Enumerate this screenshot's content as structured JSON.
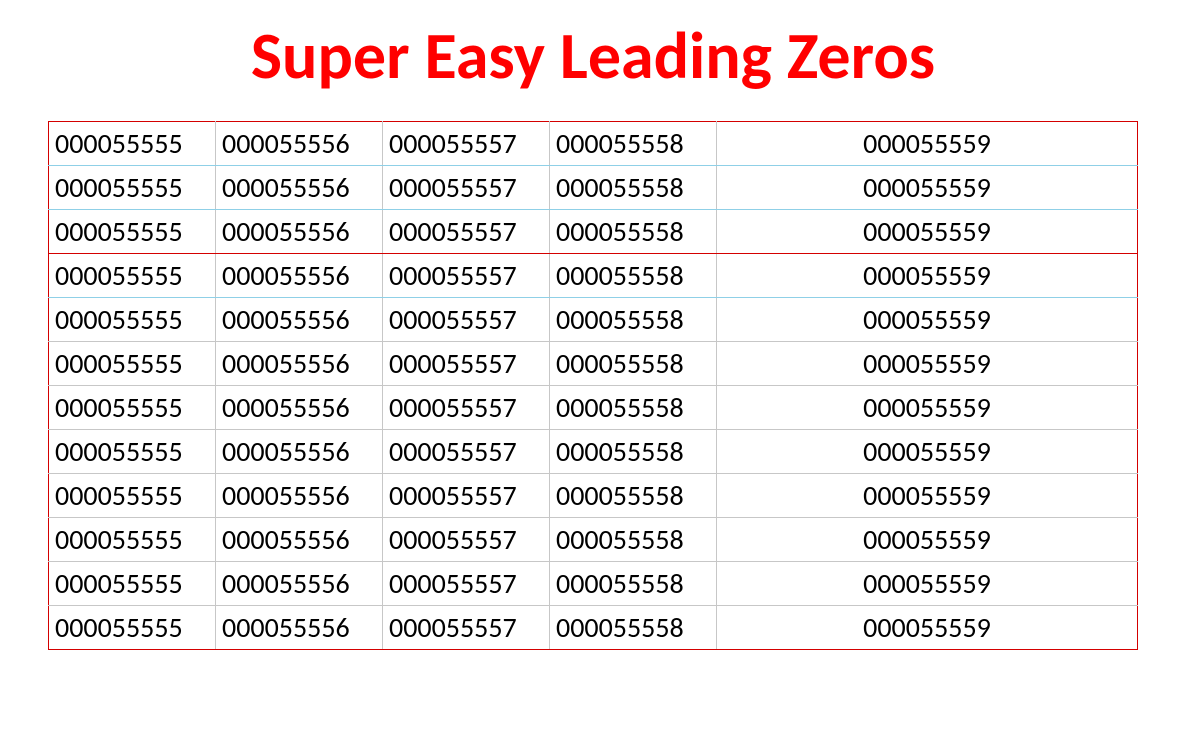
{
  "title": "Super Easy Leading Zeros",
  "columns": [
    {
      "align": "left",
      "width": "narrow"
    },
    {
      "align": "left",
      "width": "narrow"
    },
    {
      "align": "left",
      "width": "narrow"
    },
    {
      "align": "left",
      "width": "narrow"
    },
    {
      "align": "center",
      "width": "wide"
    }
  ],
  "rows": [
    {
      "cells": [
        "000055555",
        "000055556",
        "000055557",
        "000055558",
        "000055559"
      ],
      "rowClass": "blue-bottom"
    },
    {
      "cells": [
        "000055555",
        "000055556",
        "000055557",
        "000055558",
        "000055559"
      ],
      "rowClass": "blue-bottom"
    },
    {
      "cells": [
        "000055555",
        "000055556",
        "000055557",
        "000055558",
        "000055559"
      ],
      "rowClass": "red-bottom"
    },
    {
      "cells": [
        "000055555",
        "000055556",
        "000055557",
        "000055558",
        "000055559"
      ],
      "rowClass": "blue-bottom"
    },
    {
      "cells": [
        "000055555",
        "000055556",
        "000055557",
        "000055558",
        "000055559"
      ],
      "rowClass": ""
    },
    {
      "cells": [
        "000055555",
        "000055556",
        "000055557",
        "000055558",
        "000055559"
      ],
      "rowClass": ""
    },
    {
      "cells": [
        "000055555",
        "000055556",
        "000055557",
        "000055558",
        "000055559"
      ],
      "rowClass": ""
    },
    {
      "cells": [
        "000055555",
        "000055556",
        "000055557",
        "000055558",
        "000055559"
      ],
      "rowClass": ""
    },
    {
      "cells": [
        "000055555",
        "000055556",
        "000055557",
        "000055558",
        "000055559"
      ],
      "rowClass": ""
    },
    {
      "cells": [
        "000055555",
        "000055556",
        "000055557",
        "000055558",
        "000055559"
      ],
      "rowClass": ""
    },
    {
      "cells": [
        "000055555",
        "000055556",
        "000055557",
        "000055558",
        "000055559"
      ],
      "rowClass": ""
    },
    {
      "cells": [
        "000055555",
        "000055556",
        "000055557",
        "000055558",
        "000055559"
      ],
      "rowClass": ""
    }
  ]
}
